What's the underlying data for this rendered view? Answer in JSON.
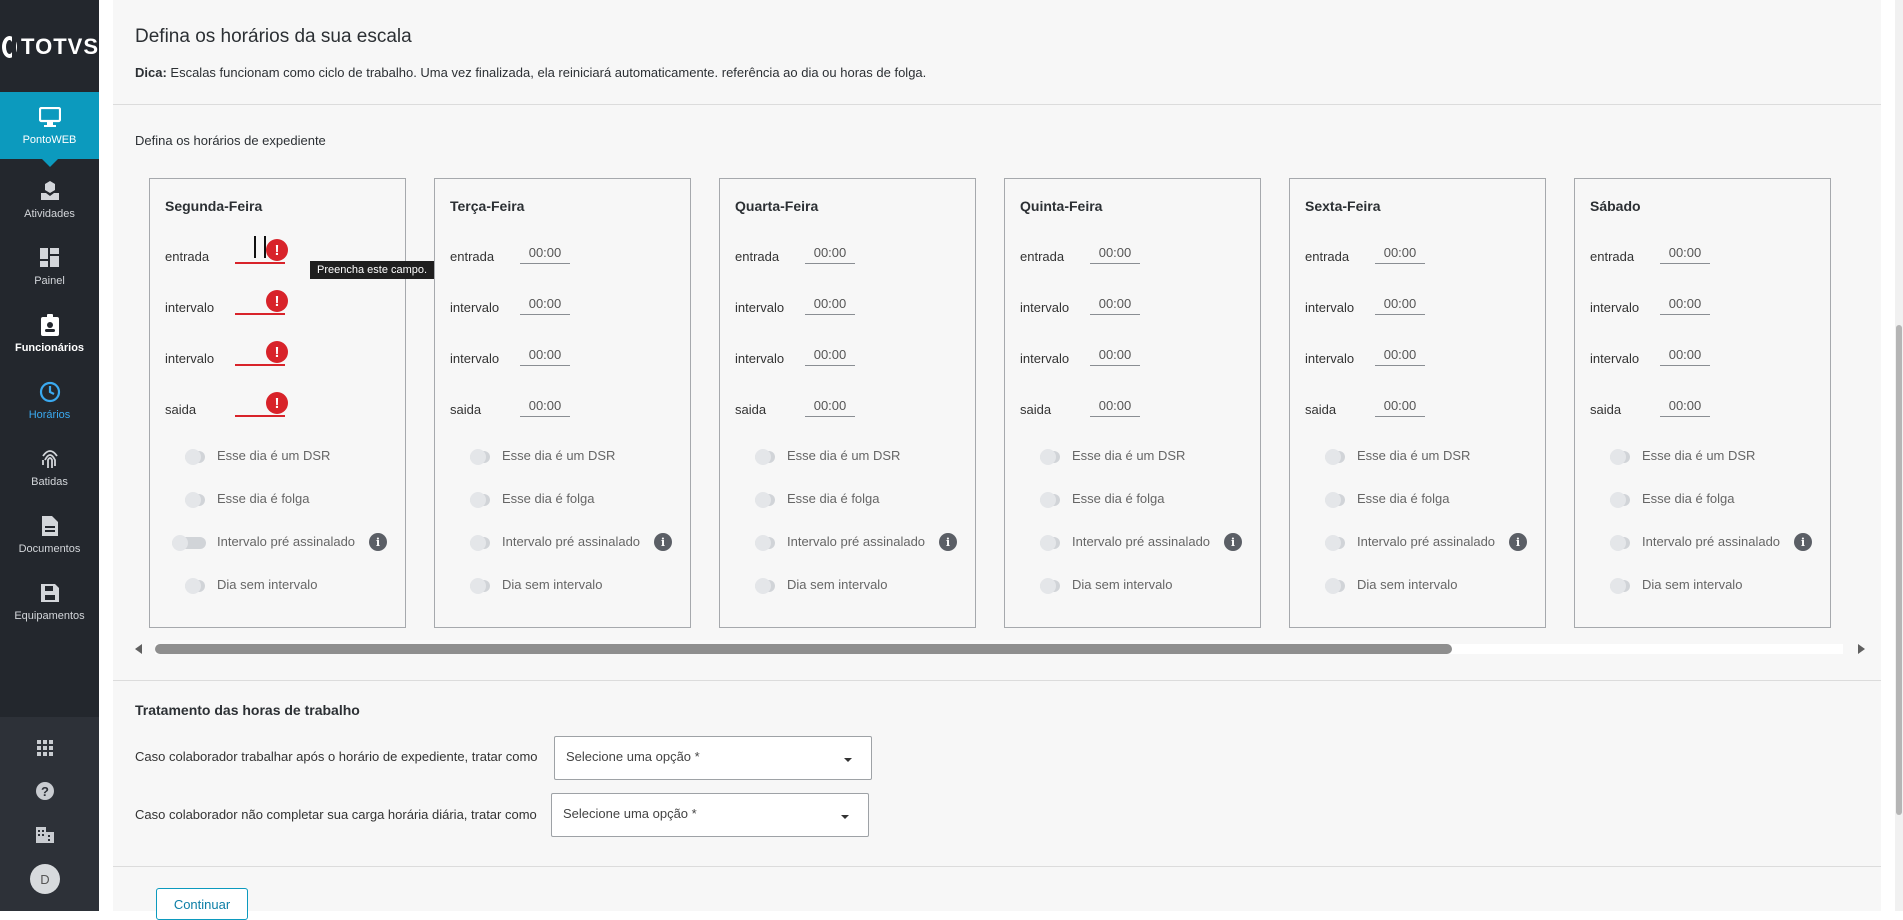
{
  "brand": {
    "logo_text": "TOTVS"
  },
  "sidebar": {
    "items": [
      {
        "label": "PontoWEB",
        "icon": "monitor-icon"
      },
      {
        "label": "Atividades",
        "icon": "book-hand-icon"
      },
      {
        "label": "Painel",
        "icon": "dashboard-icon"
      },
      {
        "label": "Funcionários",
        "icon": "badge-icon"
      },
      {
        "label": "Horários",
        "icon": "clock-icon"
      },
      {
        "label": "Batidas",
        "icon": "fingerprint-icon"
      },
      {
        "label": "Documentos",
        "icon": "document-icon"
      },
      {
        "label": "Equipamentos",
        "icon": "save-device-icon"
      }
    ],
    "bottom_icons": [
      "apps-grid-icon",
      "help-icon",
      "building-icon"
    ],
    "avatar_initial": "D"
  },
  "header": {
    "title": "Defina os horários da sua escala",
    "tip_label": "Dica:",
    "tip_text": " Escalas funcionam como ciclo de trabalho. Uma vez finalizada, ela reiniciará automaticamente. referência ao dia ou horas de folga."
  },
  "schedule": {
    "section_label": "Defina os horários de expediente",
    "row_labels": [
      "entrada",
      "intervalo",
      "intervalo",
      "saida"
    ],
    "toggle_labels": [
      "Esse dia é um DSR",
      "Esse dia é folga",
      "Intervalo pré assinalado",
      "Dia sem intervalo"
    ],
    "tooltip": "Preencha este campo.",
    "error_mark": "!",
    "info_mark": "i",
    "days": [
      {
        "name": "Segunda-Feira",
        "times": [
          "",
          "",
          "",
          ""
        ]
      },
      {
        "name": "Terça-Feira",
        "times": [
          "00:00",
          "00:00",
          "00:00",
          "00:00"
        ]
      },
      {
        "name": "Quarta-Feira",
        "times": [
          "00:00",
          "00:00",
          "00:00",
          "00:00"
        ]
      },
      {
        "name": "Quinta-Feira",
        "times": [
          "00:00",
          "00:00",
          "00:00",
          "00:00"
        ]
      },
      {
        "name": "Sexta-Feira",
        "times": [
          "00:00",
          "00:00",
          "00:00",
          "00:00"
        ]
      },
      {
        "name": "Sábado",
        "times": [
          "00:00",
          "00:00",
          "00:00",
          "00:00"
        ]
      }
    ]
  },
  "treatment": {
    "title": "Tratamento das horas de trabalho",
    "q1_label": "Caso colaborador trabalhar após o horário de expediente, tratar como",
    "q1_placeholder": "Selecione uma opção *",
    "q2_label": "Caso colaborador não completar sua carga horária diária, tratar como",
    "q2_placeholder": "Selecione uma opção *"
  },
  "actions": {
    "continue_label": "Continuar"
  },
  "colors": {
    "sidebar_bg": "#23272d",
    "accent": "#0c9abe",
    "error": "#d8232a"
  }
}
